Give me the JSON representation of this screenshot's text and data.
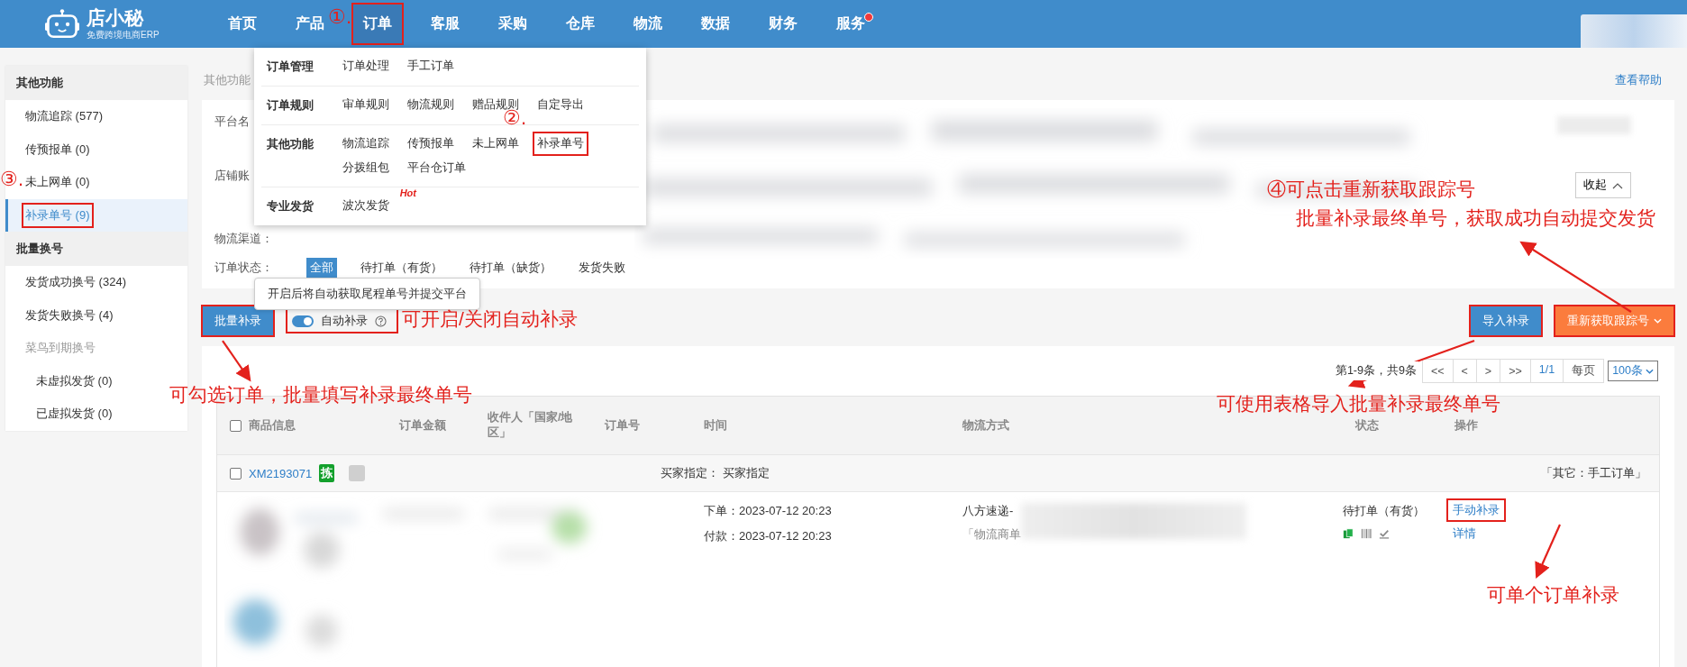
{
  "app": {
    "logo_name": "店小秘",
    "logo_tagline": "免费跨境电商ERP"
  },
  "nav": [
    {
      "label": "首页",
      "selected": false,
      "dot": false,
      "highlighted": false
    },
    {
      "label": "产品",
      "selected": false,
      "dot": false,
      "highlighted": false
    },
    {
      "label": "订单",
      "selected": true,
      "dot": false,
      "highlighted": true
    },
    {
      "label": "客服",
      "selected": false,
      "dot": false,
      "highlighted": false
    },
    {
      "label": "采购",
      "selected": false,
      "dot": false,
      "highlighted": false
    },
    {
      "label": "仓库",
      "selected": false,
      "dot": false,
      "highlighted": false
    },
    {
      "label": "物流",
      "selected": false,
      "dot": false,
      "highlighted": false
    },
    {
      "label": "数据",
      "selected": false,
      "dot": false,
      "highlighted": false
    },
    {
      "label": "财务",
      "selected": false,
      "dot": false,
      "highlighted": false
    },
    {
      "label": "服务",
      "selected": false,
      "dot": true,
      "highlighted": false
    }
  ],
  "nav_dropdown": {
    "groups": [
      {
        "title": "订单管理",
        "links": [
          {
            "label": "订单处理",
            "highlighted": false
          },
          {
            "label": "手工订单",
            "highlighted": false
          }
        ]
      },
      {
        "title": "订单规则",
        "links": [
          {
            "label": "审单规则",
            "highlighted": false
          },
          {
            "label": "物流规则",
            "highlighted": false
          },
          {
            "label": "赠品规则",
            "highlighted": false
          },
          {
            "label": "自定导出",
            "highlighted": false
          }
        ]
      },
      {
        "title": "其他功能",
        "links": [
          {
            "label": "物流追踪",
            "highlighted": false
          },
          {
            "label": "传预报单",
            "highlighted": false
          },
          {
            "label": "未上网单",
            "highlighted": false
          },
          {
            "label": "补录单号",
            "highlighted": true
          },
          {
            "label": "分拨组包",
            "highlighted": false
          },
          {
            "label": "平台仓订单",
            "highlighted": false
          }
        ]
      },
      {
        "title": "专业发货",
        "links": [
          {
            "label": "波次发货",
            "badge": "Hot",
            "highlighted": false
          }
        ]
      }
    ]
  },
  "sidebar": {
    "sections": [
      {
        "title": "其他功能",
        "items": [
          {
            "label": "物流追踪 (577)",
            "selected": false,
            "highlighted": false
          },
          {
            "label": "传预报单 (0)",
            "selected": false,
            "highlighted": false
          },
          {
            "label": "未上网单 (0)",
            "selected": false,
            "highlighted": false
          },
          {
            "label": "补录单号 (9)",
            "selected": true,
            "highlighted": true
          }
        ]
      },
      {
        "title": "批量换号",
        "items": [
          {
            "label": "发货成功换号 (324)",
            "selected": false,
            "highlighted": false
          },
          {
            "label": "发货失败换号 (4)",
            "selected": false,
            "highlighted": false
          },
          {
            "label": "菜鸟到期换号",
            "selected": false,
            "highlighted": false,
            "disabled": true,
            "children": [
              {
                "label": "未虚拟发货 (0)",
                "selected": false,
                "highlighted": false
              },
              {
                "label": "已虚拟发货 (0)",
                "selected": false,
                "highlighted": false
              }
            ]
          }
        ]
      }
    ]
  },
  "breadcrumb": "其他功能",
  "help_link": "查看帮助",
  "filters": {
    "rows": [
      {
        "label": "平台名"
      },
      {
        "label": "店铺账"
      },
      {
        "label": "物流渠道："
      },
      {
        "label": "订单状态：",
        "options": [
          {
            "label": "全部",
            "selected": true
          },
          {
            "label": "待打单（有货）",
            "selected": false
          },
          {
            "label": "待打单（缺货）",
            "selected": false
          },
          {
            "label": "发货失败",
            "selected": false
          }
        ]
      }
    ],
    "collapse_button": "收起"
  },
  "tooltip": "开启后将自动获取尾程单号并提交平台",
  "toolbar": {
    "batch_button": {
      "label": "批量补录",
      "highlighted": true
    },
    "auto_toggle": {
      "label": "自动补录",
      "on": true,
      "highlighted": true
    },
    "import_button": {
      "label": "导入补录",
      "highlighted": true
    },
    "refetch_button": {
      "label": "重新获取跟踪号",
      "highlighted": true
    }
  },
  "pagination": {
    "summary": "第1-9条，共9条",
    "buttons": [
      "<<",
      "<",
      ">",
      ">>"
    ],
    "page": "1/1",
    "per_page_label": "每页",
    "per_page": "100条"
  },
  "table": {
    "select_all_checked": false,
    "columns": [
      "商品信息",
      "订单金额",
      "收件人「国家/地区」",
      "订单号",
      "时间",
      "物流方式",
      "状态",
      "操作"
    ],
    "orders": [
      {
        "checked": false,
        "order_no": "XM2193071",
        "tag": "拣",
        "buyer_label": "买家指定：",
        "buyer_value": "买家指定",
        "source": "「其它：手工订单」",
        "times": [
          "下单：2023-07-12 20:23",
          "付款：2023-07-12 20:23"
        ],
        "shipping": "八方速递-",
        "shipping_note": "「物流商单",
        "status": "待打单（有货）",
        "actions": [
          {
            "label": "手动补录",
            "highlighted": true
          },
          {
            "label": "详情",
            "highlighted": false
          }
        ]
      }
    ]
  },
  "annotations": [
    {
      "kind": "step",
      "text": "①."
    },
    {
      "kind": "step",
      "text": "②."
    },
    {
      "kind": "step",
      "text": "③."
    },
    {
      "kind": "note",
      "text": "④可点击重新获取跟踪号"
    },
    {
      "kind": "note",
      "text": "批量补录最终单号，获取成功自动提交发货"
    },
    {
      "kind": "note",
      "text": "可开启/关闭自动补录"
    },
    {
      "kind": "note",
      "text": "可勾选订单，批量填写补录最终单号"
    },
    {
      "kind": "note",
      "text": "可使用表格导入批量补录最终单号"
    },
    {
      "kind": "note",
      "text": "可单个订单补录"
    }
  ]
}
